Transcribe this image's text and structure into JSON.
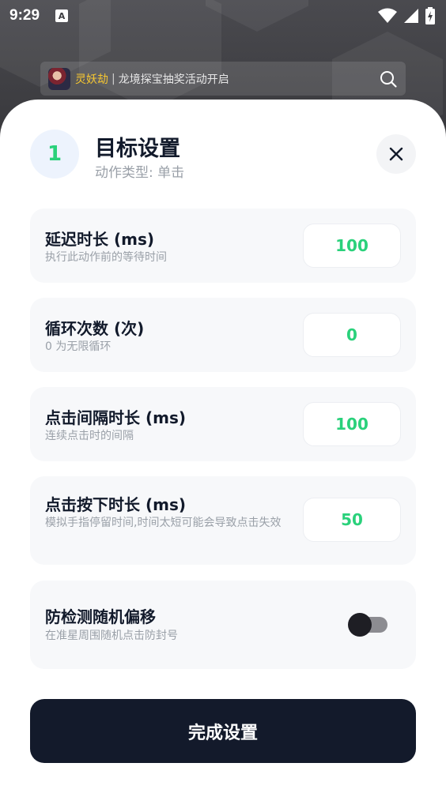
{
  "status_bar": {
    "time": "9:29",
    "notification_icon": "A"
  },
  "banner": {
    "user_name": "灵妖劫",
    "separator": "|",
    "message": "龙境探宝抽奖活动开启"
  },
  "dialog": {
    "step_number": "1",
    "title": "目标设置",
    "subtitle": "动作类型: 单击",
    "settings": [
      {
        "label": "延迟时长 (ms)",
        "description": "执行此动作前的等待时间",
        "value": "100"
      },
      {
        "label": "循环次数 (次)",
        "description": "0 为无限循环",
        "value": "0"
      },
      {
        "label": "点击间隔时长 (ms)",
        "description": "连续点击时的间隔",
        "value": "100"
      },
      {
        "label": "点击按下时长 (ms)",
        "description": "模拟手指停留时间,时间太短可能会导致点击失效",
        "value": "50"
      }
    ],
    "anti_detect": {
      "label": "防检测随机偏移",
      "description": "在准星周围随机点击防封号",
      "enabled": false
    },
    "done_label": "完成设置"
  },
  "colors": {
    "accent_green": "#2ad17b",
    "dark_button": "#131a2b",
    "card_bg": "#f7f8fa",
    "banner_name": "#f4c531"
  }
}
